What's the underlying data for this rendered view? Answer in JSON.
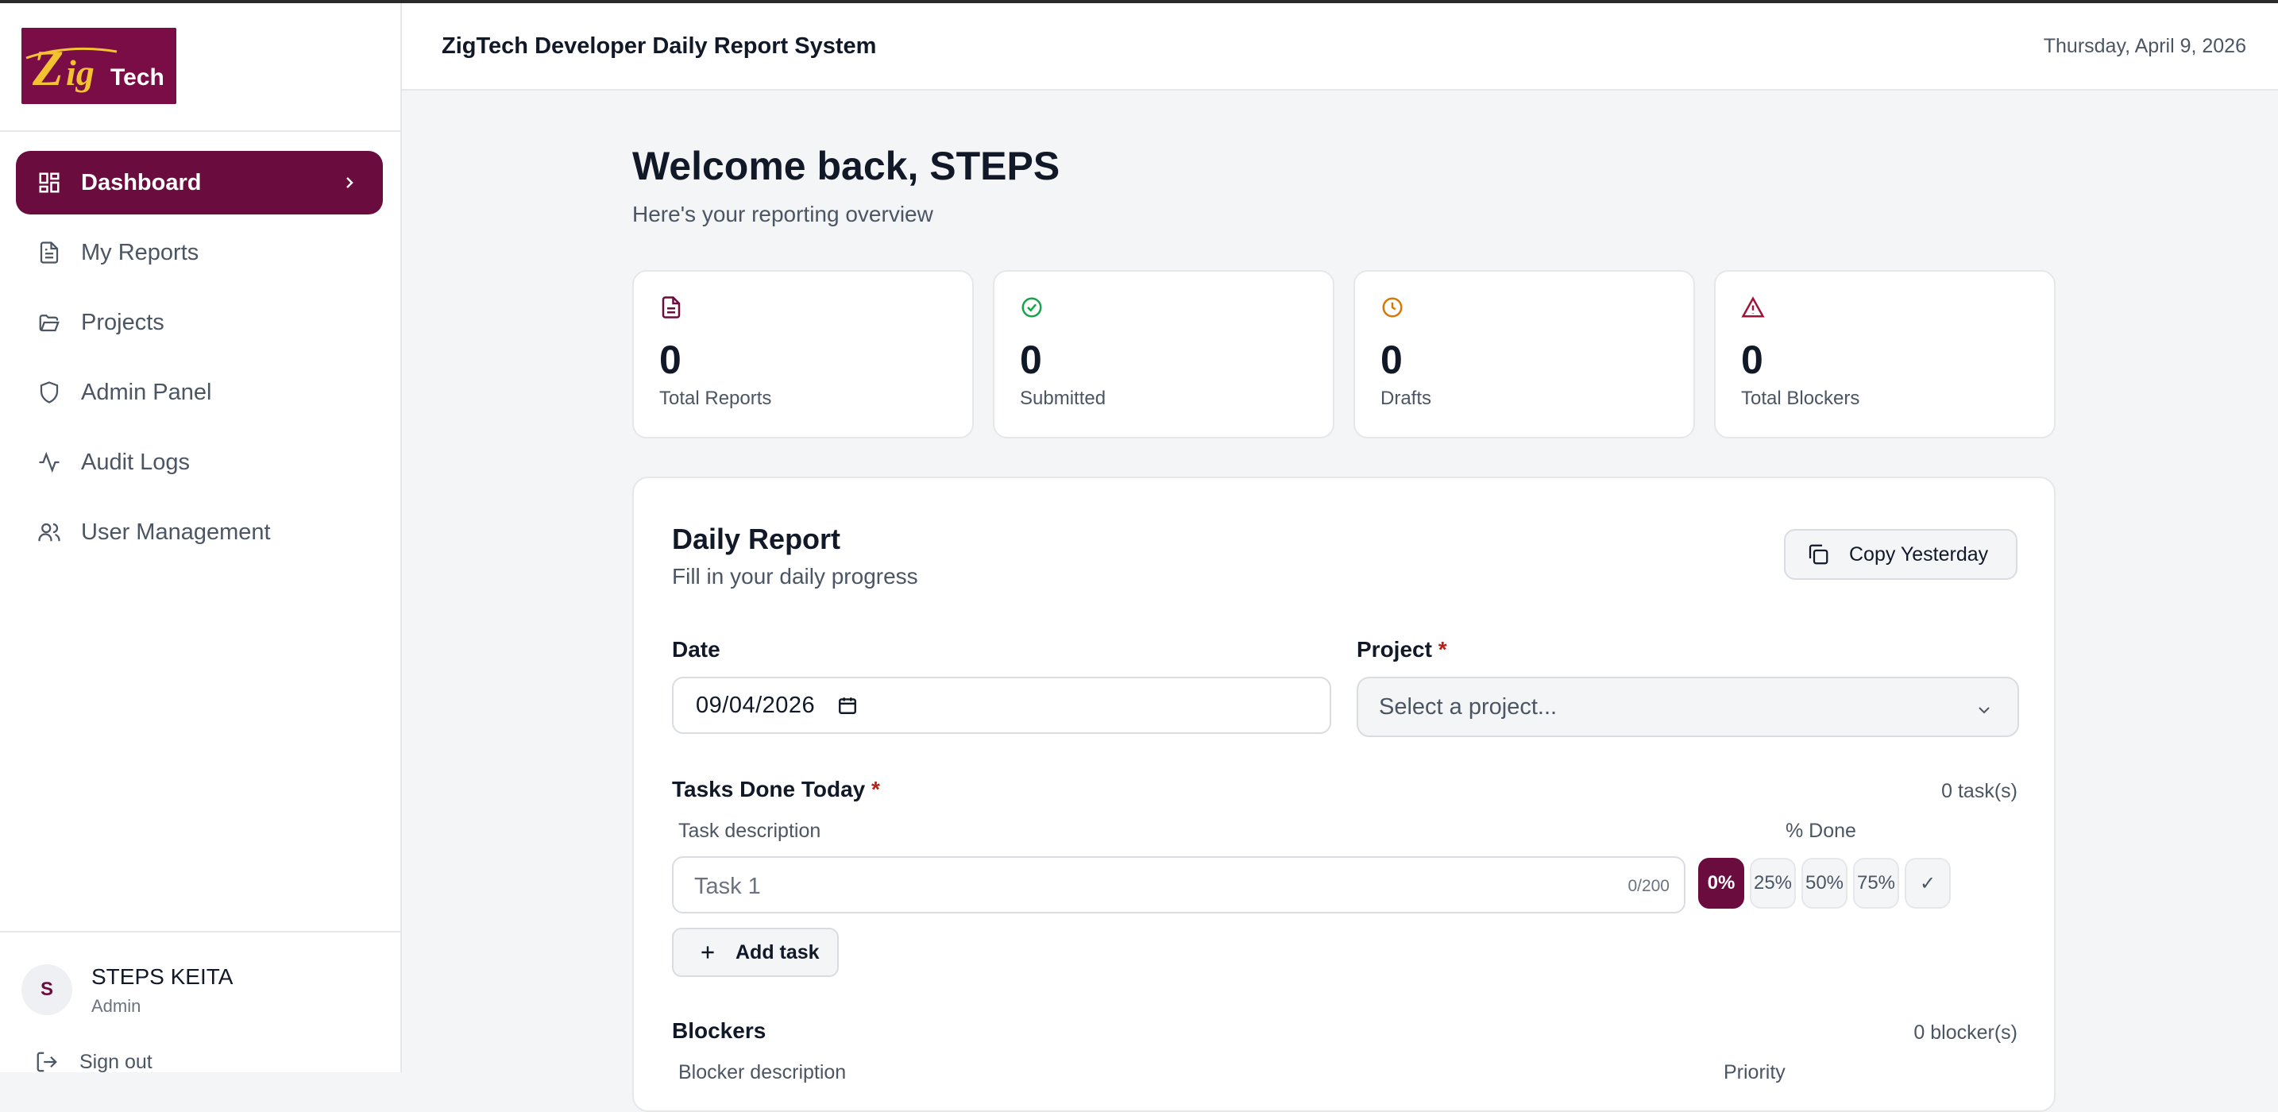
{
  "app": {
    "logo_text": "ZigTech",
    "header_title": "ZigTech Developer Daily Report System",
    "date": "Thursday, April 9, 2026"
  },
  "sidebar": {
    "items": [
      {
        "label": "Dashboard",
        "icon": "dashboard-icon",
        "active": true
      },
      {
        "label": "My Reports",
        "icon": "file-text-icon"
      },
      {
        "label": "Projects",
        "icon": "folder-open-icon"
      },
      {
        "label": "Admin Panel",
        "icon": "shield-icon"
      },
      {
        "label": "Audit Logs",
        "icon": "activity-icon"
      },
      {
        "label": "User Management",
        "icon": "users-icon"
      }
    ],
    "user": {
      "initial": "S",
      "name": "STEPS KEITA",
      "role": "Admin"
    },
    "signout_label": "Sign out"
  },
  "welcome": {
    "title": "Welcome back, STEPS",
    "subtitle": "Here's your reporting overview"
  },
  "stats": [
    {
      "value": "0",
      "label": "Total Reports",
      "icon": "file-text-icon",
      "color": "#6b0c3f"
    },
    {
      "value": "0",
      "label": "Submitted",
      "icon": "check-circle-icon",
      "color": "#16a34a"
    },
    {
      "value": "0",
      "label": "Drafts",
      "icon": "clock-icon",
      "color": "#d97706"
    },
    {
      "value": "0",
      "label": "Total Blockers",
      "icon": "alert-triangle-icon",
      "color": "#9f1239"
    }
  ],
  "report": {
    "title": "Daily Report",
    "subtitle": "Fill in your daily progress",
    "copy_label": "Copy Yesterday",
    "date_label": "Date",
    "date_value": "09/04/2026",
    "project_label": "Project",
    "required_mark": "*",
    "project_placeholder": "Select a project...",
    "tasks_label": "Tasks Done Today",
    "tasks_count": "0 task(s)",
    "task_col": "Task description",
    "done_col": "% Done",
    "task_placeholder": "Task 1",
    "char_count": "0/200",
    "pct_options": [
      "0%",
      "25%",
      "50%",
      "75%",
      "✓"
    ],
    "add_task_label": "Add task",
    "blockers_label": "Blockers",
    "blockers_count": "0 blocker(s)",
    "blocker_col": "Blocker description",
    "priority_col": "Priority"
  },
  "colors": {
    "brand": "#6b0c3f",
    "logo_bg": "#7a0d46",
    "logo_gold": "#f2c230"
  }
}
